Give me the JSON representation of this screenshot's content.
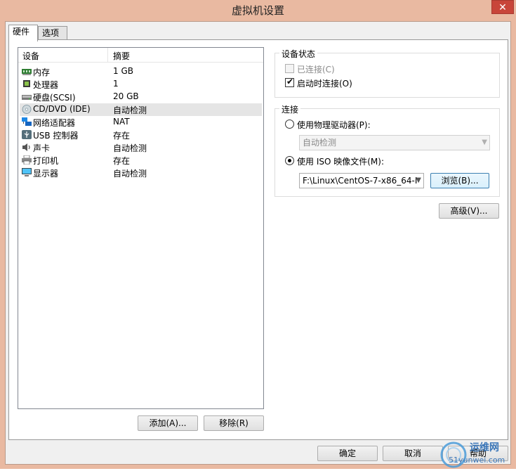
{
  "window": {
    "title": "虚拟机设置",
    "close_label": "✕"
  },
  "tabs": [
    {
      "label": "硬件"
    },
    {
      "label": "选项"
    }
  ],
  "device_list": {
    "headers": {
      "device": "设备",
      "summary": "摘要"
    },
    "rows": [
      {
        "name": "内存",
        "summary": "1 GB",
        "icon": "memory-icon"
      },
      {
        "name": "处理器",
        "summary": "1",
        "icon": "processor-icon"
      },
      {
        "name": "硬盘(SCSI)",
        "summary": "20 GB",
        "icon": "hard-disk-icon"
      },
      {
        "name": "CD/DVD (IDE)",
        "summary": "自动检测",
        "icon": "cd-dvd-icon",
        "selected": true
      },
      {
        "name": "网络适配器",
        "summary": "NAT",
        "icon": "network-adapter-icon"
      },
      {
        "name": "USB 控制器",
        "summary": "存在",
        "icon": "usb-controller-icon"
      },
      {
        "name": "声卡",
        "summary": "自动检测",
        "icon": "sound-card-icon"
      },
      {
        "name": "打印机",
        "summary": "存在",
        "icon": "printer-icon"
      },
      {
        "name": "显示器",
        "summary": "自动检测",
        "icon": "display-icon"
      }
    ]
  },
  "list_buttons": {
    "add": "添加(A)...",
    "remove": "移除(R)"
  },
  "device_status": {
    "title": "设备状态",
    "connected": {
      "label": "已连接(C)",
      "checked": false,
      "disabled": true
    },
    "connect_at_power_on": {
      "label": "启动时连接(O)",
      "checked": true
    }
  },
  "connection": {
    "title": "连接",
    "physical_drive": {
      "label": "使用物理驱动器(P):",
      "selected": false,
      "dropdown_value": "自动检测"
    },
    "iso_image": {
      "label": "使用 ISO 映像文件(M):",
      "selected": true,
      "path": "F:\\Linux\\CentOS-7-x86_64-I",
      "browse_label": "浏览(B)..."
    }
  },
  "advanced_button": "高级(V)...",
  "footer": {
    "ok": "确定",
    "cancel": "取消",
    "help": "帮助"
  },
  "watermark": {
    "site": "运维网",
    "url": "51yunwei.com"
  },
  "colors": {
    "titlebar": "#e9b9a1",
    "close_button": "#c8453a",
    "selection": "#e5e5e5"
  }
}
